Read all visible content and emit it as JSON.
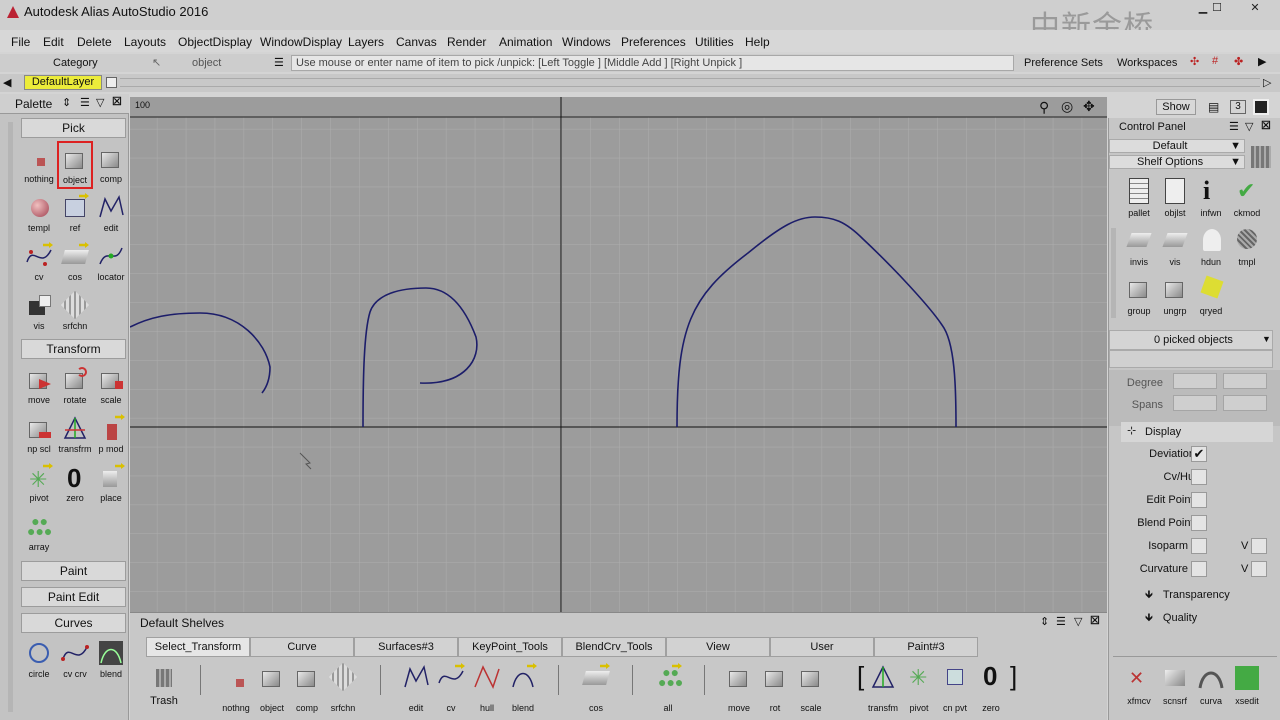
{
  "app": {
    "title": "Autodesk Alias AutoStudio 2016",
    "watermark": "中新金桥"
  },
  "menu": [
    "File",
    "Edit",
    "Delete",
    "Layouts",
    "ObjectDisplay",
    "WindowDisplay",
    "Layers",
    "Canvas",
    "Render",
    "Animation",
    "Windows",
    "Preferences",
    "Utilities",
    "Help"
  ],
  "pickbar": {
    "category": "Category",
    "object": "object",
    "prompt": "Use mouse or enter name of item to pick /unpick: [Left Toggle ] [Middle Add ] [Right Unpick ]",
    "pref_sets": "Preference Sets",
    "workspaces": "Workspaces"
  },
  "layer": {
    "active": "DefaultLayer"
  },
  "palette": {
    "title": "Palette",
    "sections": {
      "pick": "Pick",
      "transform": "Transform",
      "paint": "Paint",
      "paint_edit": "Paint Edit",
      "curves": "Curves"
    },
    "pick_tools": [
      "nothing",
      "object",
      "comp",
      "templ",
      "ref",
      "edit",
      "cv",
      "cos",
      "locator",
      "vis",
      "srfchn"
    ],
    "transform_tools": [
      "move",
      "rotate",
      "scale",
      "np scl",
      "transfrm",
      "p mod",
      "pivot",
      "zero",
      "place",
      "array"
    ],
    "curve_tools": [
      "circle",
      "cv crv",
      "blend"
    ]
  },
  "viewport": {
    "scale_label": "100",
    "show_button": "Show",
    "layout_num": "3"
  },
  "shelves": {
    "title": "Default Shelves",
    "tabs": [
      "Select_Transform",
      "Curve",
      "Surfaces#3",
      "KeyPoint_Tools",
      "BlendCrv_Tools",
      "View",
      "User",
      "Paint#3"
    ],
    "items": [
      "Trash",
      "nothng",
      "object",
      "comp",
      "srfchn",
      "edit",
      "cv",
      "hull",
      "blend",
      "cos",
      "all",
      "move",
      "rot",
      "scale",
      "transfm",
      "pivot",
      "cn pvt",
      "zero"
    ]
  },
  "control_panel": {
    "title": "Control Panel",
    "default": "Default",
    "shelf_options": "Shelf Options",
    "icons": [
      "pallet",
      "objlst",
      "infwn",
      "ckmod",
      "invis",
      "vis",
      "hdun",
      "tmpl",
      "group",
      "ungrp",
      "qryed"
    ],
    "picked": "0 picked objects",
    "degree": "Degree",
    "spans": "Spans",
    "display": "Display",
    "options": [
      {
        "label": "Deviation",
        "checked": true
      },
      {
        "label": "Cv/Hull",
        "checked": false
      },
      {
        "label": "Edit Points",
        "checked": false
      },
      {
        "label": "Blend Points",
        "checked": false
      },
      {
        "label": "Isoparm U",
        "checked": false
      },
      {
        "label": "Curvature U",
        "checked": false
      }
    ],
    "v_label": "V",
    "transparency": "Transparency",
    "quality": "Quality",
    "bottom_icons": [
      "xfmcv",
      "scnsrf",
      "curva",
      "xsedit"
    ]
  }
}
